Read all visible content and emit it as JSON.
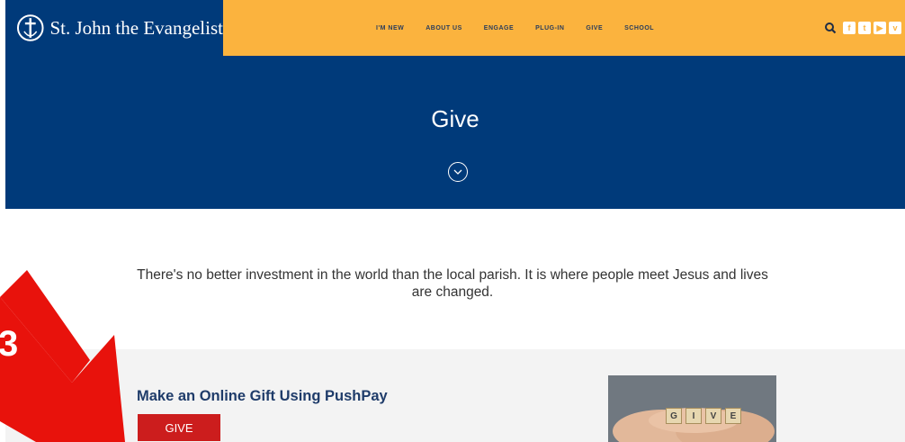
{
  "header": {
    "brand_name": "St. John the Evangelist",
    "nav_items": [
      "I'M NEW",
      "ABOUT US",
      "ENGAGE",
      "PLUG-IN",
      "GIVE",
      "SCHOOL"
    ],
    "icons": [
      "search-icon",
      "facebook-icon",
      "twitter-icon",
      "youtube-icon",
      "vimeo-icon"
    ],
    "colors": {
      "brand_bg": "#003a7a",
      "nav_bg": "#fbb33e"
    }
  },
  "hero": {
    "title": "Give"
  },
  "intro": {
    "text": "There's no better investment in the world than the local parish. It is where people meet Jesus and lives are changed."
  },
  "section": {
    "title": "Make an Online Gift Using PushPay",
    "button_label": "GIVE",
    "photo_tiles": [
      "G",
      "I",
      "V",
      "E"
    ]
  },
  "annotation": {
    "label": "3",
    "color": "#e8120c"
  }
}
